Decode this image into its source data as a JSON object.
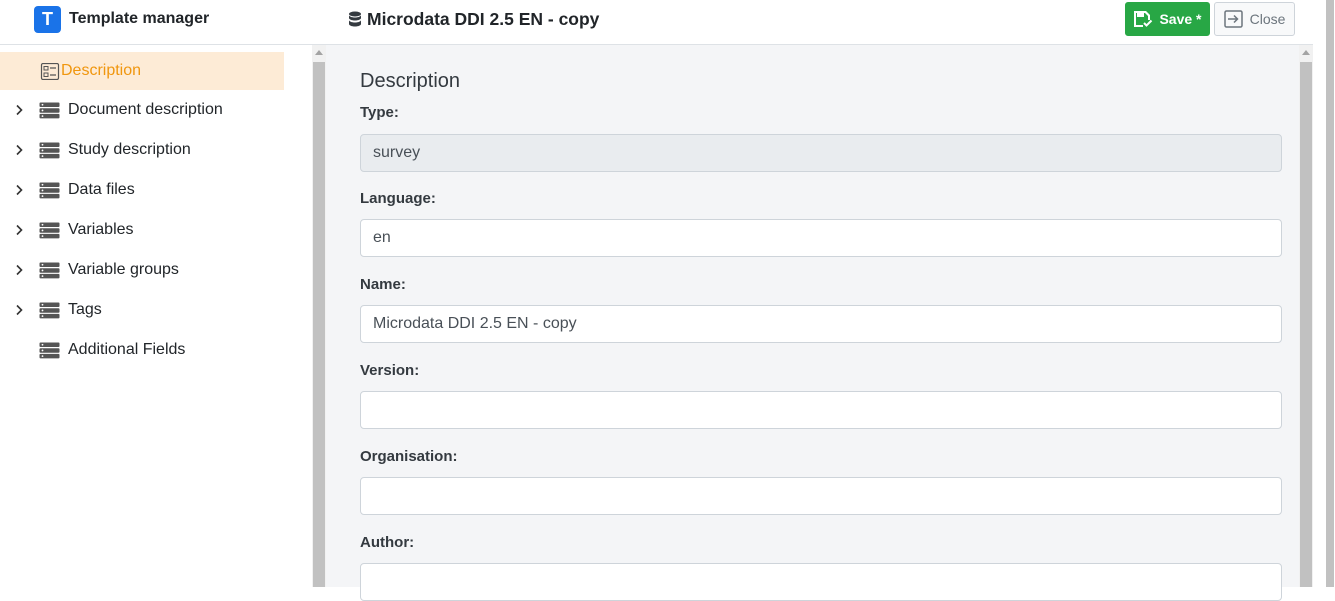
{
  "header": {
    "logo_letter": "T",
    "app_title": "Template manager",
    "doc_title": "Microdata DDI 2.5 EN - copy",
    "save_label": "Save *",
    "close_label": "Close"
  },
  "sidebar": {
    "items": [
      {
        "label": "Description",
        "icon": "form-icon",
        "expandable": false,
        "active": true
      },
      {
        "label": "Document description",
        "icon": "database-icon",
        "expandable": true
      },
      {
        "label": "Study description",
        "icon": "database-icon",
        "expandable": true
      },
      {
        "label": "Data files",
        "icon": "database-icon",
        "expandable": true
      },
      {
        "label": "Variables",
        "icon": "database-icon",
        "expandable": true
      },
      {
        "label": "Variable groups",
        "icon": "database-icon",
        "expandable": true
      },
      {
        "label": "Tags",
        "icon": "database-icon",
        "expandable": true
      },
      {
        "label": "Additional Fields",
        "icon": "database-icon",
        "expandable": false
      }
    ]
  },
  "main": {
    "section_title": "Description",
    "fields": [
      {
        "label": "Type:",
        "value": "survey",
        "readonly": true
      },
      {
        "label": "Language:",
        "value": "en"
      },
      {
        "label": "Name:",
        "value": "Microdata DDI 2.5 EN - copy"
      },
      {
        "label": "Version:",
        "value": ""
      },
      {
        "label": "Organisation:",
        "value": ""
      },
      {
        "label": "Author:",
        "value": ""
      }
    ]
  },
  "colors": {
    "accent_orange": "#f0960e",
    "active_bg": "#fdebd6",
    "save_green": "#28a745",
    "logo_blue": "#1a73e8"
  }
}
